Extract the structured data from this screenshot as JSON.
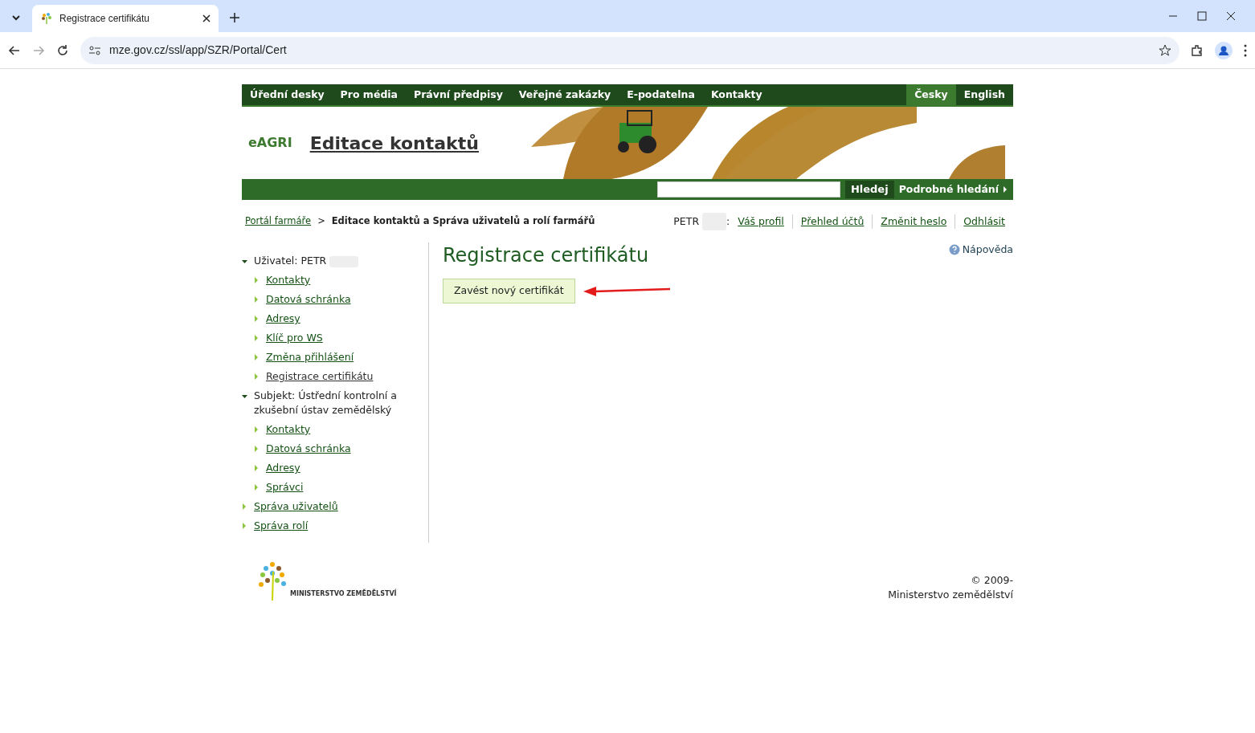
{
  "browser": {
    "tab_title": "Registrace certifikátu",
    "url": "mze.gov.cz/ssl/app/SZR/Portal/Cert"
  },
  "top_nav": {
    "items": [
      "Úřední desky",
      "Pro média",
      "Právní předpisy",
      "Veřejné zakázky",
      "E-podatelna",
      "Kontakty"
    ],
    "languages": [
      {
        "label": "Česky",
        "selected": true
      },
      {
        "label": "English",
        "selected": false
      }
    ]
  },
  "header": {
    "logo": "eAGRI",
    "title": "Editace kontaktů"
  },
  "search": {
    "button": "Hledej",
    "advanced": "Podrobné hledání"
  },
  "breadcrumb": {
    "items": [
      "Portál farmáře",
      "Editace kontaktů a Správa uživatelů a rolí farmářů"
    ],
    "separator": ">"
  },
  "user_bar": {
    "name": "PETR",
    "separator": ":",
    "links": [
      "Váš profil",
      "Přehled účtů",
      "Změnit heslo",
      "Odhlásit"
    ]
  },
  "sidebar": {
    "items": [
      {
        "label": "Uživatel: PETR",
        "expanded": true,
        "children": [
          {
            "label": "Kontakty",
            "selected": false
          },
          {
            "label": "Datová schránka",
            "selected": false
          },
          {
            "label": "Adresy",
            "selected": false
          },
          {
            "label": "Klíč pro WS",
            "selected": false
          },
          {
            "label": "Změna přihlášení",
            "selected": false
          },
          {
            "label": "Registrace certifikátu",
            "selected": true
          }
        ]
      },
      {
        "label": "Subjekt: Ústřední kontrolní a zkušební ústav zemědělský",
        "expanded": true,
        "children": [
          {
            "label": "Kontakty",
            "selected": false
          },
          {
            "label": "Datová schránka",
            "selected": false
          },
          {
            "label": "Adresy",
            "selected": false
          },
          {
            "label": "Správci",
            "selected": false
          }
        ]
      },
      {
        "label": "Správa uživatelů",
        "selected": false
      },
      {
        "label": "Správa rolí",
        "selected": false
      }
    ]
  },
  "content": {
    "help": "Nápověda",
    "title": "Registrace certifikátu",
    "action_button": "Zavést nový certifikát"
  },
  "footer": {
    "logo_text": "MINISTERSTVO ZEMĚDĚLSTVÍ",
    "copyright": "© 2009-",
    "owner": "Ministerstvo zemědělství"
  }
}
